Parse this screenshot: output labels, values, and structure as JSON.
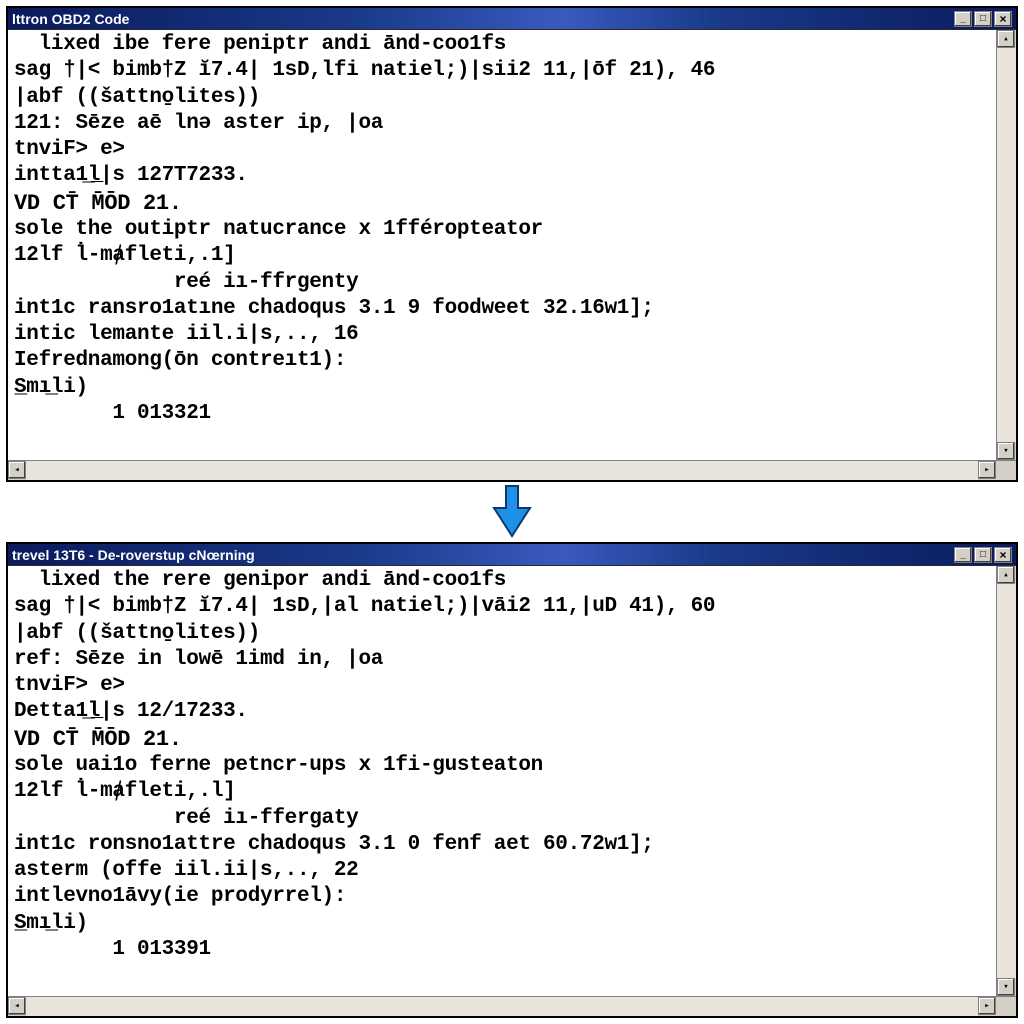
{
  "arrow": {
    "name": "down-arrow"
  },
  "windows": [
    {
      "title": "lttron OBD2 Code",
      "lines": [
        "  lixed ibe fere peniptr andi ānd-coo1fs",
        "sag †|< bimb†Z ĭ7.4| 1sD,lfi natiel;)|sii2 11,|ōf 21), 46",
        "|abf ((šattno̱lites))",
        "121: Sēze aē lnə aster ip, |oa",
        "tnviF> e>",
        "intta1̲l̲|s 127T7233.",
        "VD CT̄ M̄ŌD 21.",
        "sole the outiptr natucrance x 1fféropteator",
        "12lf l̇-mⱥfleti,.1]",
        "             reé iı-ffrgenty",
        "int1c ransro1atıne chadoqus 3.1 9 foodweet 32.16w1];",
        "",
        "intic lemante iil.i|s,.., 16",
        "",
        "Iefrednamong(ōn contreıt1):",
        "S̲mı̲li)",
        "        1 013321"
      ]
    },
    {
      "title": "trevel 13T6 - De-roverstup cNœrning",
      "lines": [
        "  lixed the rere genipor andi ānd-coo1fs",
        "sag †|< bimb†Z ĭ7.4| 1sD,|al natiel;)|vāi2 11,|uD 41), 60",
        "|abf ((šattno̱lites))",
        "ref: Sēze in lowē 1imd in, |oa",
        "tnviF> e>",
        "Detta1̲l̲|s 12/17233.",
        "VD CT̄ M̄ŌD 21.",
        "sole uai1o ferne petncr-ups x 1fi-gusteaton",
        "12lf l̇-mⱥfleti,.l]",
        "             reé iı-ffergaty",
        "int1c ronsno1attre chadoqus 3.1 0 fenf aet 60.72w1];",
        "",
        "asterm (offe iil.ii|s,.., 22",
        "",
        "intlevno1āvy(ie prodyrrel):",
        "S̲mı̲li)",
        "        1 013391"
      ]
    }
  ]
}
